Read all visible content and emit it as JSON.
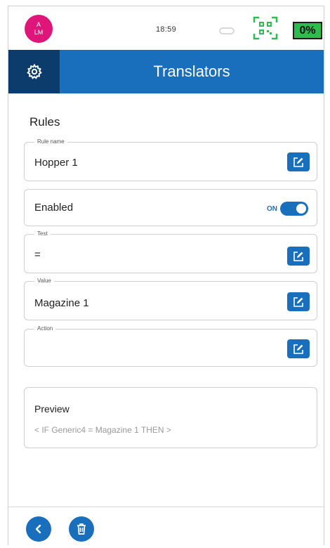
{
  "status": {
    "avatar_line1": "A",
    "avatar_line2": "LM",
    "time": "18:59",
    "battery": "0%",
    "icons": [
      "cloud-icon",
      "qr-scan-icon"
    ]
  },
  "header": {
    "title": "Translators",
    "settings_icon": "gear-icon"
  },
  "section": {
    "title": "Rules"
  },
  "fields": {
    "rule_name": {
      "label": "Rule name",
      "value": "Hopper 1"
    },
    "enabled": {
      "label": "Enabled",
      "state": "ON"
    },
    "test": {
      "label": "Test",
      "value": "="
    },
    "value": {
      "label": "Value",
      "value": "Magazine 1"
    },
    "action": {
      "label": "Action",
      "value": ""
    }
  },
  "preview": {
    "title": "Preview",
    "text": "< IF Generic4 = Magazine 1 THEN  >"
  },
  "footer": {
    "back_icon": "chevron-left-icon",
    "delete_icon": "trash-icon"
  },
  "colors": {
    "primary": "#1a6fbd",
    "header_dark": "#0c3c6b",
    "avatar": "#e0157a",
    "battery": "#2dbd4f"
  }
}
